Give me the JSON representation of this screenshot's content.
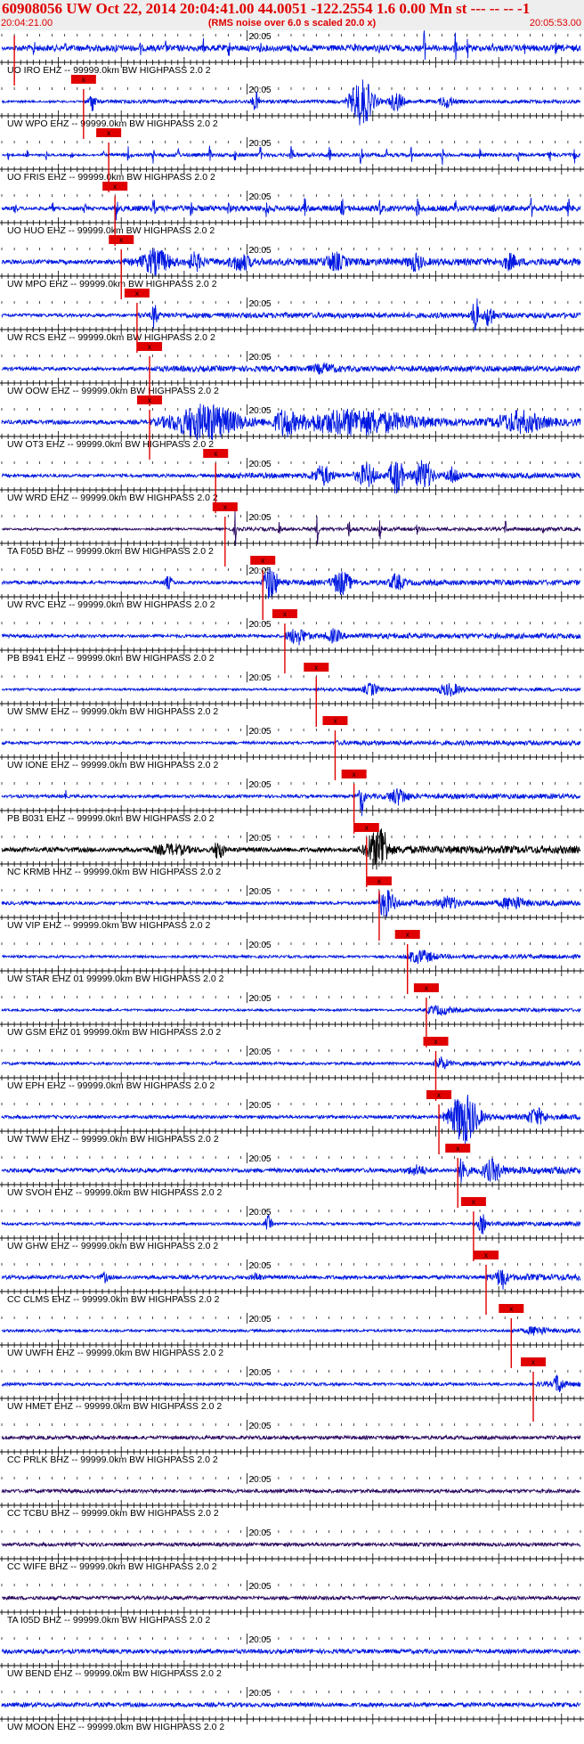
{
  "header": {
    "title": "60908056 UW Oct 22, 2014 20:04:41.00   44.0051 -122.2554  1.6 0.00 Mn st --- -- --  -1",
    "start_time": "20:04:21.00",
    "note": "(RMS noise over 6.0 s scaled 20.0 x)",
    "end_time": "20:05:53.00"
  },
  "chart_data": {
    "type": "line",
    "x_unit": "seconds after 20:04:21.00",
    "xlim": [
      0,
      92
    ],
    "tick_label": "20:05",
    "tick_label_time": 39,
    "pick_label": "x",
    "colors": {
      "blue": "#0018e0",
      "black": "#000000",
      "purple": "#2a0a60",
      "pick": "#e00000"
    },
    "series": [
      {
        "label": "UO IRO EHZ -- 99999.0km BW  HIGHPASS  2.0  2",
        "color": "blue",
        "pick": 2.0,
        "noise": 0.12,
        "bursts": [
          [
            0,
            92,
            0.05
          ],
          [
            5,
            0.4,
            0.5
          ],
          [
            10,
            0.3,
            0.4
          ],
          [
            14,
            0.3,
            0.4
          ],
          [
            18,
            0.3,
            0.4
          ],
          [
            22,
            0.3,
            0.4
          ],
          [
            26,
            0.3,
            0.4
          ],
          [
            32,
            0.3,
            0.4
          ],
          [
            36,
            0.4,
            0.5
          ],
          [
            41,
            0.3,
            0.4
          ],
          [
            46,
            0.3,
            0.4
          ],
          [
            56,
            0.3,
            0.3
          ],
          [
            60,
            0.3,
            0.3
          ],
          [
            67,
            0.6,
            0.9
          ],
          [
            72,
            0.5,
            0.7
          ],
          [
            74,
            0.4,
            0.5
          ],
          [
            78,
            0.3,
            0.3
          ],
          [
            83,
            0.3,
            0.4
          ],
          [
            88,
            0.3,
            0.4
          ]
        ]
      },
      {
        "label": "UW WPO EHZ -- 99999.0km BW  HIGHPASS  2.0  2",
        "color": "blue",
        "pick": 13.0,
        "noise": 0.1,
        "bursts": [
          [
            14,
            1.5,
            0.5
          ],
          [
            40,
            1.5,
            0.5
          ],
          [
            56,
            5,
            1.3
          ],
          [
            62,
            3,
            0.5
          ],
          [
            70,
            3,
            0.3
          ]
        ]
      },
      {
        "label": "UO FRIS EHZ -- 99999.0km BW  HIGHPASS  2.0  2",
        "color": "blue",
        "pick": 17.0,
        "noise": 0.1,
        "bursts": [
          [
            1,
            0.4,
            0.5
          ],
          [
            4,
            0.4,
            0.5
          ],
          [
            7,
            0.3,
            0.4
          ],
          [
            11,
            0.4,
            0.5
          ],
          [
            16,
            0.4,
            0.5
          ],
          [
            20,
            0.4,
            0.5
          ],
          [
            24,
            0.4,
            0.5
          ],
          [
            28,
            0.4,
            0.5
          ],
          [
            33,
            0.4,
            0.5
          ],
          [
            37,
            0.3,
            0.4
          ],
          [
            41,
            0.4,
            0.6
          ],
          [
            46,
            0.6,
            0.8
          ],
          [
            52,
            0.5,
            0.6
          ],
          [
            57,
            0.5,
            0.6
          ],
          [
            61,
            0.4,
            0.5
          ],
          [
            65,
            0.4,
            0.5
          ],
          [
            70,
            0.4,
            0.5
          ],
          [
            76,
            0.4,
            0.5
          ],
          [
            82,
            0.4,
            0.5
          ],
          [
            87,
            0.4,
            0.5
          ],
          [
            91,
            0.4,
            0.7
          ]
        ]
      },
      {
        "label": "UO HUO EHZ -- 99999.0km BW  HIGHPASS  2.0  2",
        "color": "blue",
        "pick": 18.0,
        "noise": 0.1,
        "bursts": [
          [
            0,
            92,
            0.06
          ],
          [
            2,
            0.6,
            0.6
          ],
          [
            8,
            0.6,
            0.5
          ],
          [
            13,
            0.6,
            0.5
          ],
          [
            18,
            0.8,
            0.6
          ],
          [
            24,
            0.6,
            0.5
          ],
          [
            30,
            0.6,
            0.5
          ],
          [
            36,
            0.5,
            0.5
          ],
          [
            42,
            0.6,
            0.5
          ],
          [
            48,
            0.6,
            0.6
          ],
          [
            54,
            0.6,
            0.5
          ],
          [
            60,
            0.6,
            0.6
          ],
          [
            66,
            0.6,
            0.6
          ],
          [
            72,
            0.5,
            0.5
          ],
          [
            78,
            0.6,
            0.5
          ],
          [
            84,
            0.6,
            0.5
          ],
          [
            90,
            0.5,
            0.5
          ]
        ]
      },
      {
        "label": "UW MPO EHZ -- 99999.0km BW  HIGHPASS  2.0  2",
        "color": "blue",
        "pick": 19.0,
        "noise": 0.2,
        "bursts": [
          [
            23,
            6,
            0.6
          ],
          [
            30,
            3,
            0.4
          ],
          [
            37,
            4,
            0.4
          ],
          [
            52,
            4,
            0.4
          ],
          [
            65,
            3,
            0.4
          ],
          [
            80,
            3,
            0.35
          ]
        ]
      },
      {
        "label": "UW RCS EHZ -- 99999.0km BW  HIGHPASS  2.0  2",
        "color": "blue",
        "pick": 21.5,
        "noise": 0.15,
        "bursts": [
          [
            24,
            1.2,
            0.7
          ],
          [
            75,
            1.2,
            1.3
          ],
          [
            77,
            2,
            0.6
          ]
        ]
      },
      {
        "label": "UW OOW EHZ -- 99999.0km BW  HIGHPASS  2.0  2",
        "color": "blue",
        "pick": 23.5,
        "noise": 0.16,
        "bursts": [
          [
            50,
            5,
            0.2
          ]
        ]
      },
      {
        "label": "UW OT3 EHZ -- 99999.0km BW  HIGHPASS  2.0  2",
        "color": "blue",
        "pick": 23.5,
        "noise": 0.2,
        "bursts": [
          [
            29,
            14,
            0.9
          ],
          [
            44,
            4,
            0.6
          ],
          [
            50,
            25,
            0.6
          ],
          [
            80,
            10,
            0.5
          ]
        ]
      },
      {
        "label": "UW WRD EHZ -- 99999.0km BW  HIGHPASS  2.0  2",
        "color": "blue",
        "pick": 34.0,
        "noise": 0.15,
        "bursts": [
          [
            50,
            4,
            0.5
          ],
          [
            57,
            4,
            0.6
          ],
          [
            62,
            3,
            1.0
          ],
          [
            66,
            4,
            0.8
          ],
          [
            71,
            3,
            0.4
          ]
        ]
      },
      {
        "label": "TA F05D BHZ -- 99999.0km BW  HIGHPASS  2.0  2",
        "color": "purple",
        "pick": 35.5,
        "noise": 0.1,
        "bursts": [
          [
            37,
            0.4,
            1.0
          ],
          [
            44,
            0.5,
            0.6
          ],
          [
            50,
            0.6,
            0.8
          ],
          [
            55,
            0.6,
            0.6
          ],
          [
            60,
            0.5,
            0.6
          ],
          [
            66,
            0.4,
            0.5
          ],
          [
            80,
            0.4,
            0.5
          ],
          [
            86,
            0.4,
            0.6
          ]
        ]
      },
      {
        "label": "UW RVC EHZ -- 99999.0km BW  HIGHPASS  2.0  2",
        "color": "blue",
        "pick": 41.5,
        "noise": 0.15,
        "bursts": [
          [
            26,
            2,
            0.5
          ],
          [
            42,
            3,
            0.9
          ],
          [
            53,
            4,
            0.6
          ],
          [
            62,
            3,
            0.4
          ]
        ]
      },
      {
        "label": "PB B941 EHZ -- 99999.0km BW  HIGHPASS  2.0  2",
        "color": "blue",
        "pick": 45.0,
        "noise": 0.15,
        "bursts": [
          [
            46,
            4,
            0.4
          ],
          [
            52,
            3,
            0.3
          ]
        ]
      },
      {
        "label": "UW SMW EHZ -- 99999.0km BW  HIGHPASS  2.0  2",
        "color": "blue",
        "pick": 50.0,
        "noise": 0.1,
        "bursts": [
          [
            58,
            3,
            0.3
          ],
          [
            70,
            5,
            0.3
          ]
        ]
      },
      {
        "label": "UW IONE EHZ -- 99999.0km BW  HIGHPASS  2.0  2",
        "color": "blue",
        "pick": 53.0,
        "noise": 0.1,
        "bursts": [
          [
            0,
            92,
            0.03
          ]
        ]
      },
      {
        "label": "PB B031 EHZ -- 99999.0km BW  HIGHPASS  2.0  2",
        "color": "blue",
        "pick": 56.0,
        "noise": 0.14,
        "bursts": [
          [
            10,
            0.4,
            0.7
          ],
          [
            57,
            1.0,
            1.0
          ],
          [
            62,
            4,
            0.4
          ]
        ]
      },
      {
        "label": "NC KRMB HHZ -- 99999.0km BW  HIGHPASS  2.0  2",
        "color": "black",
        "pick": 58.0,
        "noise": 0.22,
        "bursts": [
          [
            25,
            8,
            0.4
          ],
          [
            34,
            2,
            0.9
          ],
          [
            58,
            5,
            0.8
          ],
          [
            60,
            2,
            1.0
          ]
        ]
      },
      {
        "label": "UW VIP EHZ -- 99999.0km BW  HIGHPASS  2.0  2",
        "color": "blue",
        "pick": 60.0,
        "noise": 0.15,
        "bursts": [
          [
            60,
            4,
            0.7
          ],
          [
            70,
            4,
            0.3
          ],
          [
            80,
            5,
            0.3
          ]
        ]
      },
      {
        "label": "UW STAR EHZ 01 99999.0km BW  HIGHPASS  2.0  2",
        "color": "blue",
        "pick": 64.5,
        "noise": 0.12,
        "bursts": [
          [
            65,
            6,
            0.3
          ]
        ]
      },
      {
        "label": "UW GSM EHZ 01 99999.0km BW  HIGHPASS  2.0  2",
        "color": "blue",
        "pick": 67.5,
        "noise": 0.1,
        "bursts": [
          [
            68,
            6,
            0.2
          ]
        ]
      },
      {
        "label": "UW EPH EHZ -- 99999.0km BW  HIGHPASS  2.0  2",
        "color": "blue",
        "pick": 69.0,
        "noise": 0.13,
        "bursts": [
          [
            34,
            0.15,
            1.0
          ],
          [
            69,
            3,
            0.3
          ]
        ]
      },
      {
        "label": "UW TWW EHZ -- 99999.0km BW  HIGHPASS  2.0  2",
        "color": "blue",
        "pick": 69.5,
        "noise": 0.15,
        "bursts": [
          [
            72,
            6,
            1.4
          ],
          [
            84,
            4,
            0.4
          ]
        ]
      },
      {
        "label": "UW SVOH EHZ -- 99999.0km BW  HIGHPASS  2.0  2",
        "color": "blue",
        "pick": 72.5,
        "noise": 0.2,
        "bursts": [
          [
            73,
            1.5,
            0.9
          ],
          [
            77,
            4,
            0.5
          ],
          [
            65,
            4,
            0.4
          ]
        ]
      },
      {
        "label": "UW GHW EHZ -- 99999.0km BW  HIGHPASS  2.0  2",
        "color": "blue",
        "pick": 75.0,
        "noise": 0.12,
        "bursts": [
          [
            42,
            1.5,
            0.7
          ],
          [
            76,
            1.5,
            0.5
          ]
        ]
      },
      {
        "label": "CC CLMS EHZ -- 99999.0km BW  HIGHPASS  2.0  2",
        "color": "blue",
        "pick": 77.0,
        "noise": 0.18,
        "bursts": [
          [
            79,
            2,
            0.6
          ],
          [
            16,
            1.5,
            0.4
          ],
          [
            40,
            2,
            0.3
          ]
        ]
      },
      {
        "label": "UW UWFH EHZ -- 99999.0km BW  HIGHPASS  2.0  2",
        "color": "blue",
        "pick": 81.0,
        "noise": 0.12,
        "bursts": [
          [
            84,
            4,
            0.2
          ]
        ]
      },
      {
        "label": "UW HMET EHZ -- 99999.0km BW  HIGHPASS  2.0  2",
        "color": "blue",
        "pick": 84.5,
        "noise": 0.14,
        "bursts": [
          [
            88,
            2,
            0.5
          ]
        ]
      },
      {
        "label": "CC PRLK BHZ -- 99999.0km BW  HIGHPASS  2.0  2",
        "color": "purple",
        "noise": 0.1,
        "bursts": []
      },
      {
        "label": "CC TCBU BHZ -- 99999.0km BW  HIGHPASS  2.0  2",
        "color": "purple",
        "noise": 0.1,
        "bursts": []
      },
      {
        "label": "CC WIFE BHZ -- 99999.0km BW  HIGHPASS  2.0  2",
        "color": "purple",
        "noise": 0.1,
        "bursts": []
      },
      {
        "label": "TA I05D BHZ -- 99999.0km BW  HIGHPASS  2.0  2",
        "color": "purple",
        "noise": 0.1,
        "bursts": []
      },
      {
        "label": "UW BEND EHZ -- 99999.0km BW  HIGHPASS  2.0  2",
        "color": "blue",
        "noise": 0.12,
        "bursts": []
      },
      {
        "label": "UW MOON EHZ -- 99999.0km BW  HIGHPASS  2.0  2",
        "color": "blue",
        "noise": 0.12,
        "bursts": []
      }
    ]
  }
}
